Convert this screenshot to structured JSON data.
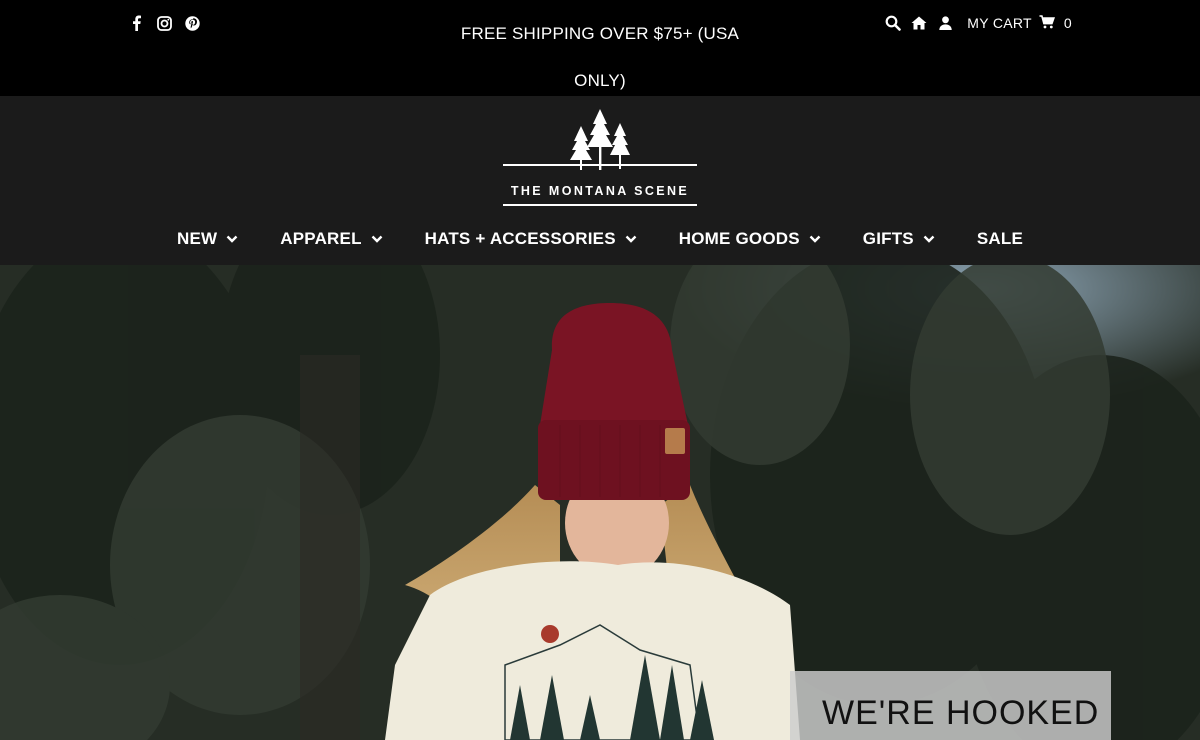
{
  "announcement": {
    "promo_text": "FREE SHIPPING OVER $75+ (USA ONLY)",
    "social_icons": [
      "facebook-icon",
      "instagram-icon",
      "pinterest-icon"
    ],
    "utility_icons": [
      "search-icon",
      "home-icon",
      "account-icon"
    ],
    "cart_label": "MY CART",
    "cart_count": "0"
  },
  "brand": {
    "name": "THE MONTANA SCENE"
  },
  "nav": {
    "items": [
      {
        "label": "NEW",
        "has_dropdown": true
      },
      {
        "label": "APPAREL",
        "has_dropdown": true
      },
      {
        "label": "HATS + ACCESSORIES",
        "has_dropdown": true
      },
      {
        "label": "HOME GOODS",
        "has_dropdown": true
      },
      {
        "label": "GIFTS",
        "has_dropdown": true
      },
      {
        "label": "SALE",
        "has_dropdown": false
      }
    ]
  },
  "hero": {
    "caption": "WE'RE HOOKED"
  },
  "colors": {
    "topbar_bg": "#000000",
    "header_bg": "#1b1b1b",
    "beanie": "#7a1424",
    "sweatshirt": "#efebdc"
  }
}
